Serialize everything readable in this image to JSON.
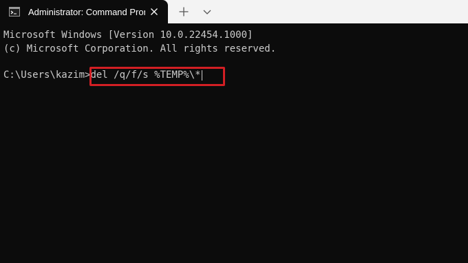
{
  "tab": {
    "title": "Administrator: Command Prompt",
    "icon": "command-prompt-icon"
  },
  "tabbar": {
    "new_tab_icon": "plus-icon",
    "dropdown_icon": "chevron-down-icon",
    "close_icon": "close-icon"
  },
  "terminal": {
    "line1": "Microsoft Windows [Version 10.0.22454.1000]",
    "line2": "(c) Microsoft Corporation. All rights reserved.",
    "prompt": "C:\\Users\\kazim>",
    "command": "del /q/f/s %TEMP%\\*"
  },
  "colors": {
    "terminal_bg": "#0c0c0c",
    "terminal_text": "#cccccc",
    "tabbar_bg": "#f3f3f3",
    "highlight_border": "#d31f24"
  }
}
